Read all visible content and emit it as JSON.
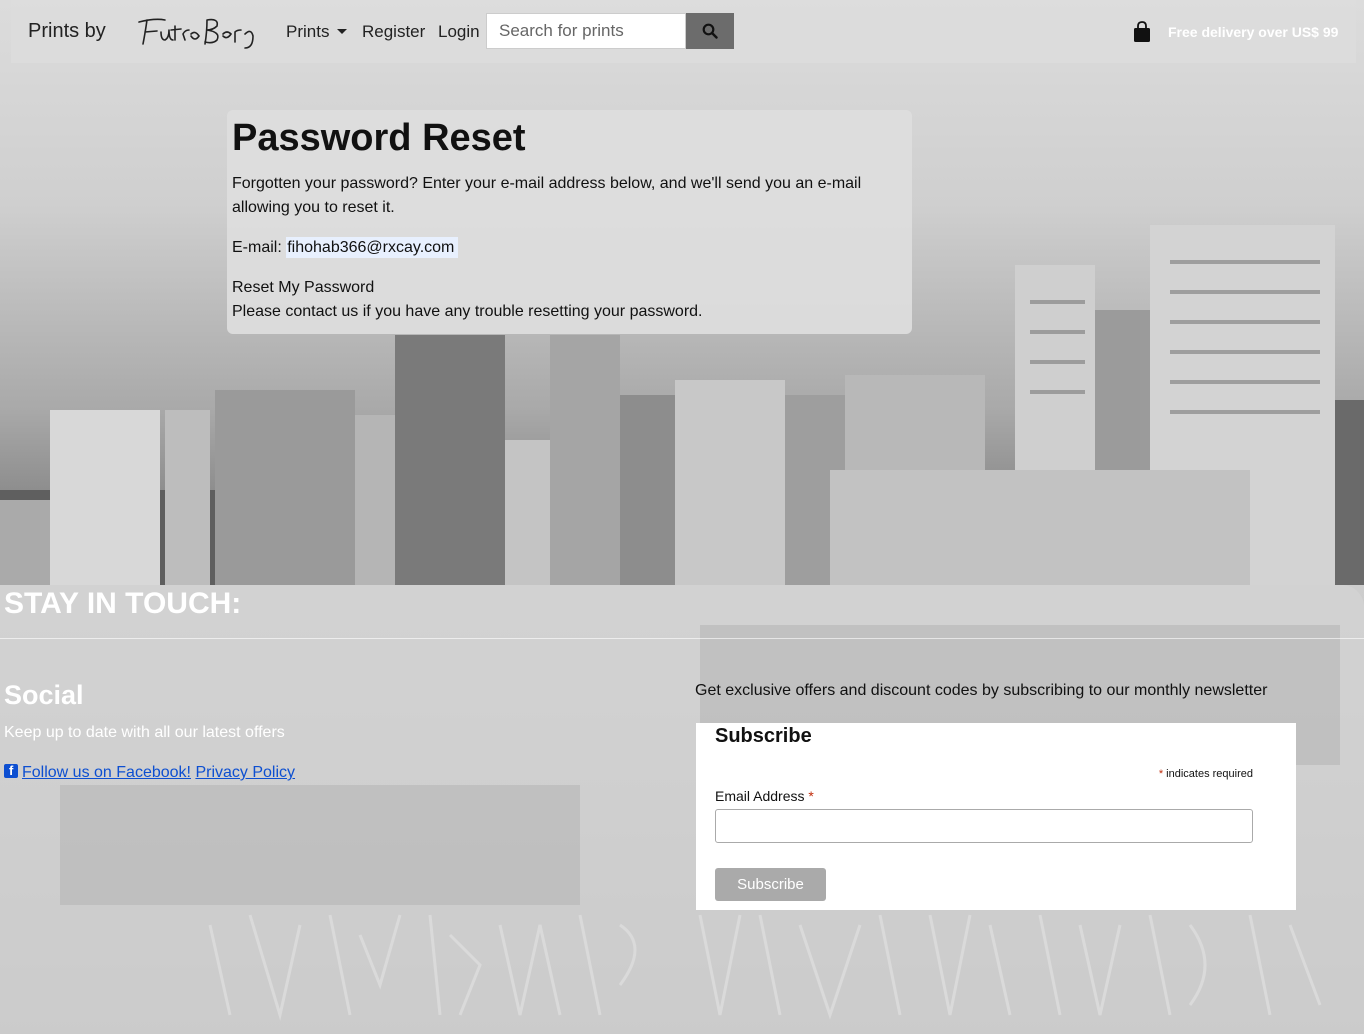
{
  "nav": {
    "brand_text": "Prints by",
    "logo_text": "Futuro Berg",
    "prints_label": "Prints",
    "register_label": "Register",
    "login_label": "Login",
    "search_placeholder": "Search for prints",
    "free_delivery": "Free delivery over US$ 99"
  },
  "reset": {
    "title": "Password Reset",
    "description": "Forgotten your password? Enter your e-mail address below, and we'll send you an e-mail allowing you to reset it.",
    "email_label": "E-mail:",
    "email_value": "fihohab366@rxcay.com",
    "button_label": "Reset My Password",
    "contact_line": "Please contact us if you have any trouble resetting your password."
  },
  "footer": {
    "stay_title": "STAY IN TOUCH:",
    "social_title": "Social",
    "social_text": "Keep up to date with all our latest offers",
    "facebook_link": "Follow us on Facebook!",
    "privacy_link": "Privacy Policy",
    "newsletter_text": "Get exclusive offers and discount codes by subscribing to our monthly newsletter",
    "subscribe_title": "Subscribe",
    "required_note": "indicates required",
    "email_label": "Email Address",
    "subscribe_button": "Subscribe"
  }
}
